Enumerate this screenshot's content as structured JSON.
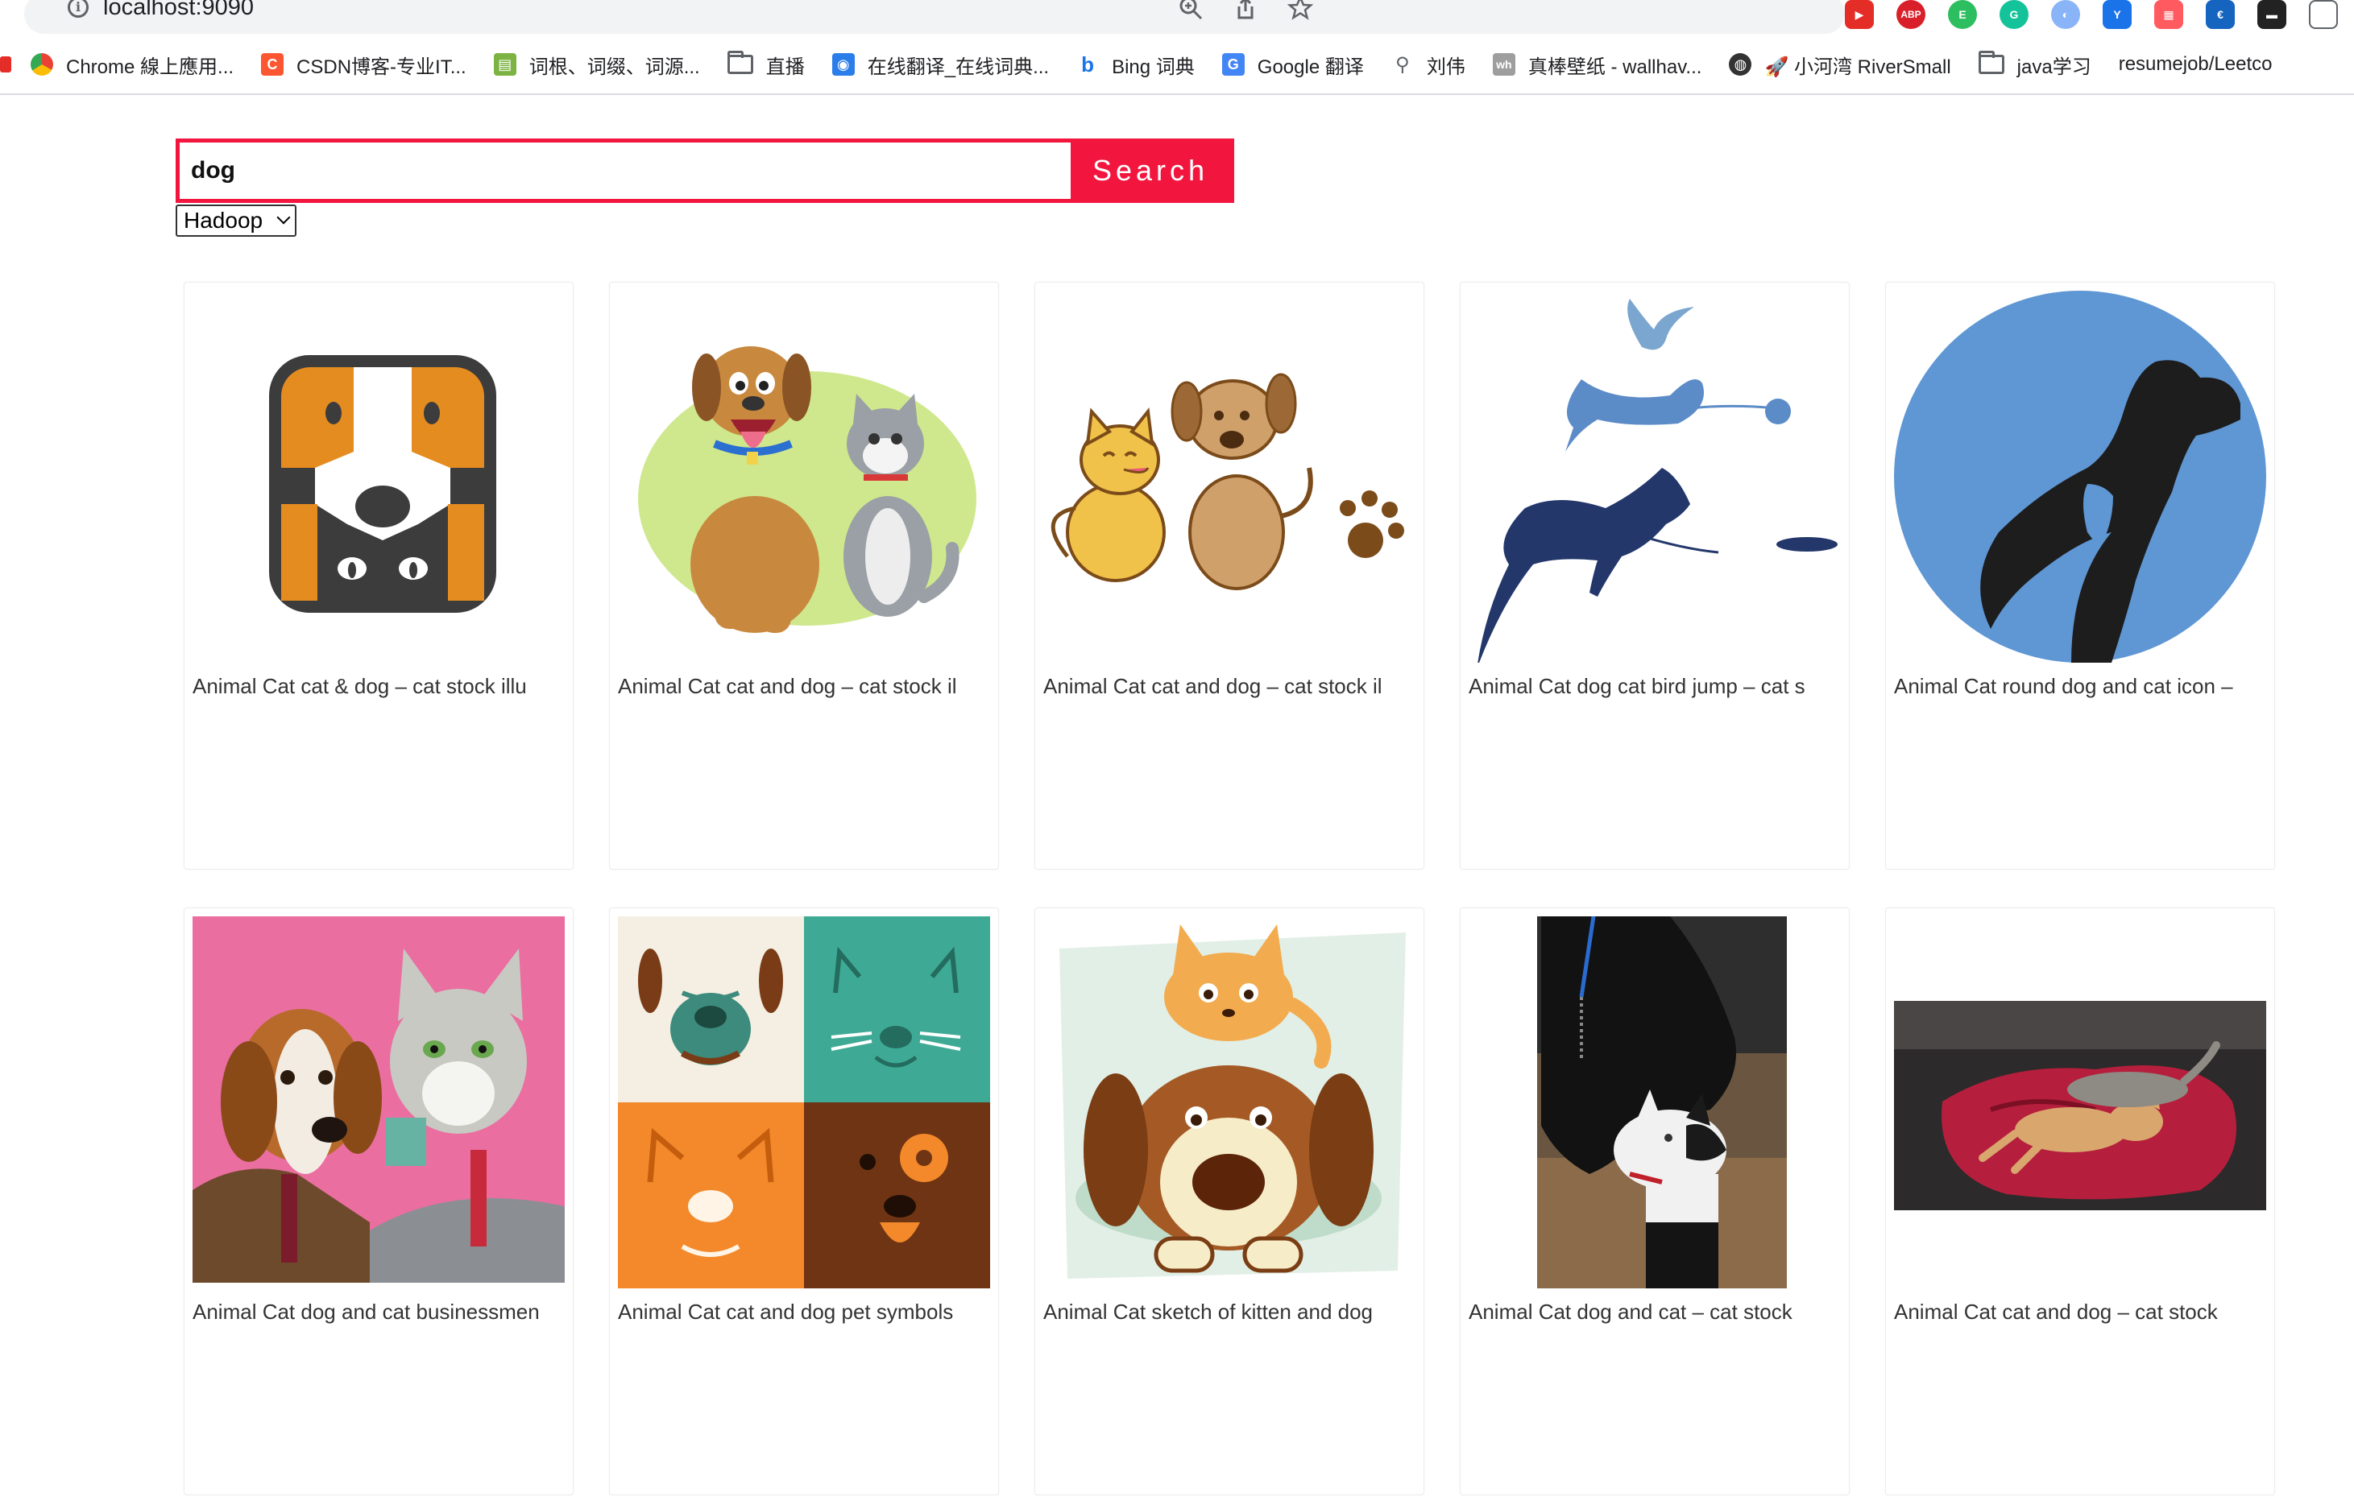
{
  "browser": {
    "url": "localhost:9090",
    "bookmarks": [
      {
        "label": "Chrome 線上應用...",
        "icon": "chrome-web-store-icon"
      },
      {
        "label": "CSDN博客-专业IT...",
        "icon": "csdn-icon"
      },
      {
        "label": "词根、词缀、词源...",
        "icon": "dictionary-icon"
      },
      {
        "label": "直播",
        "icon": "folder-icon"
      },
      {
        "label": "在线翻译_在线词典...",
        "icon": "translate-icon"
      },
      {
        "label": "Bing 词典",
        "icon": "bing-icon"
      },
      {
        "label": "Google 翻译",
        "icon": "google-translate-icon"
      },
      {
        "label": "刘伟",
        "icon": "person-icon"
      },
      {
        "label": "真棒壁纸 - wallhav...",
        "icon": "wallhaven-icon"
      },
      {
        "label": "🚀 小河湾 RiverSmall",
        "icon": "globe-icon"
      },
      {
        "label": "java学习",
        "icon": "folder-icon"
      },
      {
        "label": "resumejob/Leetco",
        "icon": "github-icon"
      }
    ]
  },
  "search": {
    "value": "dog",
    "button_label": "Search",
    "engine_selected": "Hadoop"
  },
  "results": [
    {
      "caption": "Animal Cat cat & dog – cat stock illu"
    },
    {
      "caption": "Animal Cat cat and dog – cat stock il"
    },
    {
      "caption": "Animal Cat cat and dog – cat stock il"
    },
    {
      "caption": "Animal Cat dog cat bird jump – cat s"
    },
    {
      "caption": "Animal Cat round dog and cat icon –"
    },
    {
      "caption": "Animal Cat dog and cat businessmen"
    },
    {
      "caption": "Animal Cat cat and dog pet symbols"
    },
    {
      "caption": "Animal Cat sketch of kitten and dog"
    },
    {
      "caption": "Animal Cat dog and cat – cat stock"
    },
    {
      "caption": "Animal Cat cat and dog – cat stock"
    }
  ],
  "colors": {
    "accent": "#f2163f"
  }
}
